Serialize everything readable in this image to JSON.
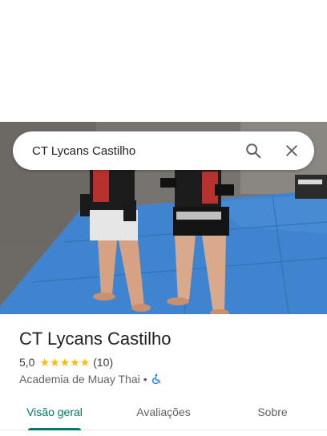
{
  "search": {
    "value": "CT Lycans Castilho"
  },
  "place": {
    "name": "CT Lycans Castilho",
    "rating": "5,0",
    "stars": "★★★★★",
    "review_count": "(10)",
    "category": "Academia de Muay Thai",
    "separator": "•",
    "accessibility_icon": "wheelchair-icon"
  },
  "tabs": [
    {
      "label": "Visão geral",
      "active": true
    },
    {
      "label": "Avaliações",
      "active": false
    },
    {
      "label": "Sobre",
      "active": false
    }
  ],
  "colors": {
    "accent": "#00796b",
    "star": "#fbbc04",
    "mat": "#3f84cf"
  }
}
